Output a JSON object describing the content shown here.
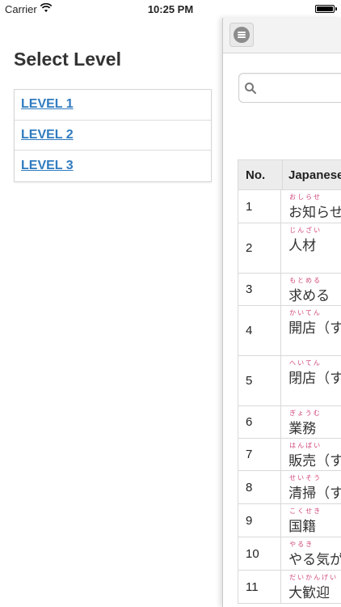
{
  "status_bar": {
    "carrier": "Carrier",
    "time": "10:25 PM",
    "battery_level": 1.0,
    "wifi_icon": "wifi-icon",
    "battery_icon": "battery-icon"
  },
  "menu": {
    "title": "Select Level",
    "levels": [
      {
        "label": "LEVEL 1"
      },
      {
        "label": "LEVEL 2"
      },
      {
        "label": "LEVEL 3"
      }
    ]
  },
  "content": {
    "menu_button_icon": "hamburger-menu-icon",
    "search": {
      "icon": "search-icon",
      "value": "",
      "placeholder": ""
    },
    "table": {
      "headers": {
        "no": "No.",
        "japanese": "Japanese"
      },
      "rows": [
        {
          "no": "1",
          "reading": "おしらせ",
          "word": "お知らせ"
        },
        {
          "no": "2",
          "reading": "じんざい",
          "word": "人材"
        },
        {
          "no": "3",
          "reading": "もとめる",
          "word": "求める"
        },
        {
          "no": "4",
          "reading": "かいてん",
          "word": "開店（す"
        },
        {
          "no": "5",
          "reading": "へいてん",
          "word": "閉店（す"
        },
        {
          "no": "6",
          "reading": "ぎょうむ",
          "word": "業務"
        },
        {
          "no": "7",
          "reading": "はんばい",
          "word": "販売（す"
        },
        {
          "no": "8",
          "reading": "せいそう",
          "word": "清掃（す"
        },
        {
          "no": "9",
          "reading": "こくせき",
          "word": "国籍"
        },
        {
          "no": "10",
          "reading": "やるき",
          "word": "やる気が"
        },
        {
          "no": "11",
          "reading": "だいかんげい",
          "word": "大歓迎"
        }
      ]
    }
  },
  "colors": {
    "link": "#2f7bbf",
    "ruby": "#d0467a",
    "header_bg": "#ececec"
  }
}
